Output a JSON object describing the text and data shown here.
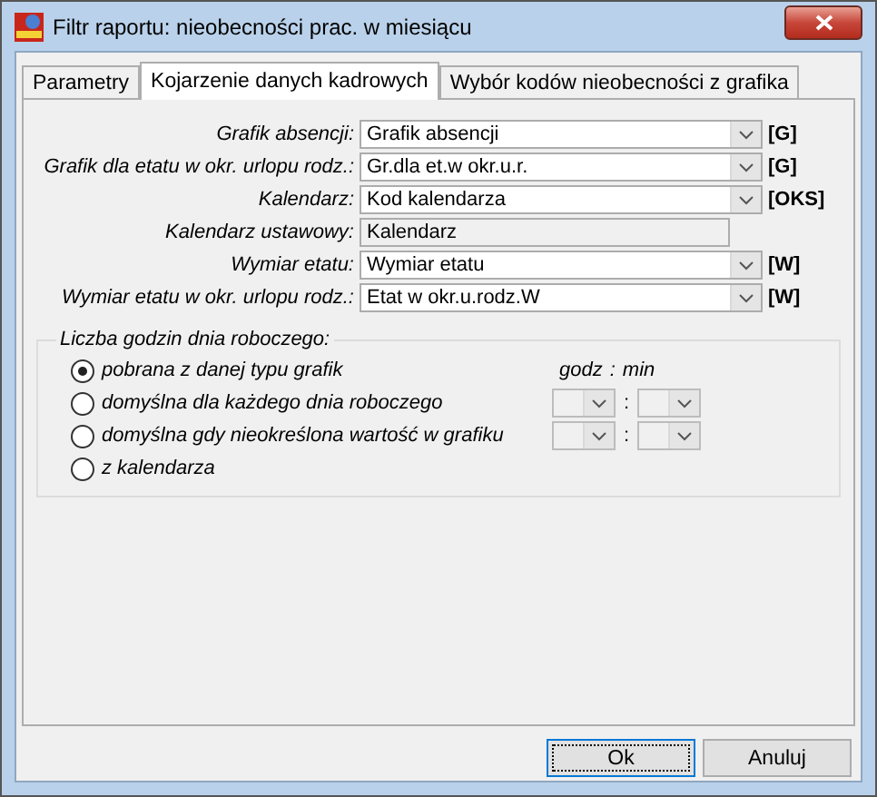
{
  "window": {
    "title": "Filtr raportu: nieobecności prac. w miesiącu"
  },
  "tabs": [
    {
      "label": "Parametry",
      "selected": false
    },
    {
      "label": "Kojarzenie danych kadrowych",
      "selected": true
    },
    {
      "label": "Wybór kodów nieobecności z grafika",
      "selected": false
    }
  ],
  "fields": [
    {
      "label": "Grafik absencji:",
      "kind": "combo",
      "value": "Grafik absencji",
      "tag": "[G]"
    },
    {
      "label": "Grafik dla etatu w okr. urlopu rodz.:",
      "kind": "combo",
      "value": "Gr.dla et.w okr.u.r.",
      "tag": "[G]"
    },
    {
      "label": "Kalendarz:",
      "kind": "combo",
      "value": "Kod kalendarza",
      "tag": "[OKS]"
    },
    {
      "label": "Kalendarz ustawowy:",
      "kind": "text",
      "value": "Kalendarz"
    },
    {
      "label": "Wymiar etatu:",
      "kind": "combo",
      "value": "Wymiar etatu",
      "tag": "[W]"
    },
    {
      "label": "Wymiar etatu w okr. urlopu rodz.:",
      "kind": "combo",
      "value": "Etat w okr.u.rodz.W",
      "tag": "[W]"
    }
  ],
  "hours_group": {
    "title": "Liczba godzin dnia roboczego:",
    "time_header": {
      "hours": "godz",
      "separator": ":",
      "minutes": "min"
    },
    "options": [
      {
        "label": "pobrana z danej typu grafik",
        "selected": true,
        "time_inputs": false
      },
      {
        "label": "domyślna dla każdego dnia roboczego",
        "selected": false,
        "time_inputs": true,
        "separator": ":"
      },
      {
        "label": "domyślna gdy nieokreślona wartość w grafiku",
        "selected": false,
        "time_inputs": true,
        "separator": ":"
      },
      {
        "label": "z kalendarza",
        "selected": false,
        "time_inputs": false
      }
    ]
  },
  "buttons": [
    {
      "label": "Ok",
      "default": true
    },
    {
      "label": "Anuluj",
      "default": false
    }
  ]
}
